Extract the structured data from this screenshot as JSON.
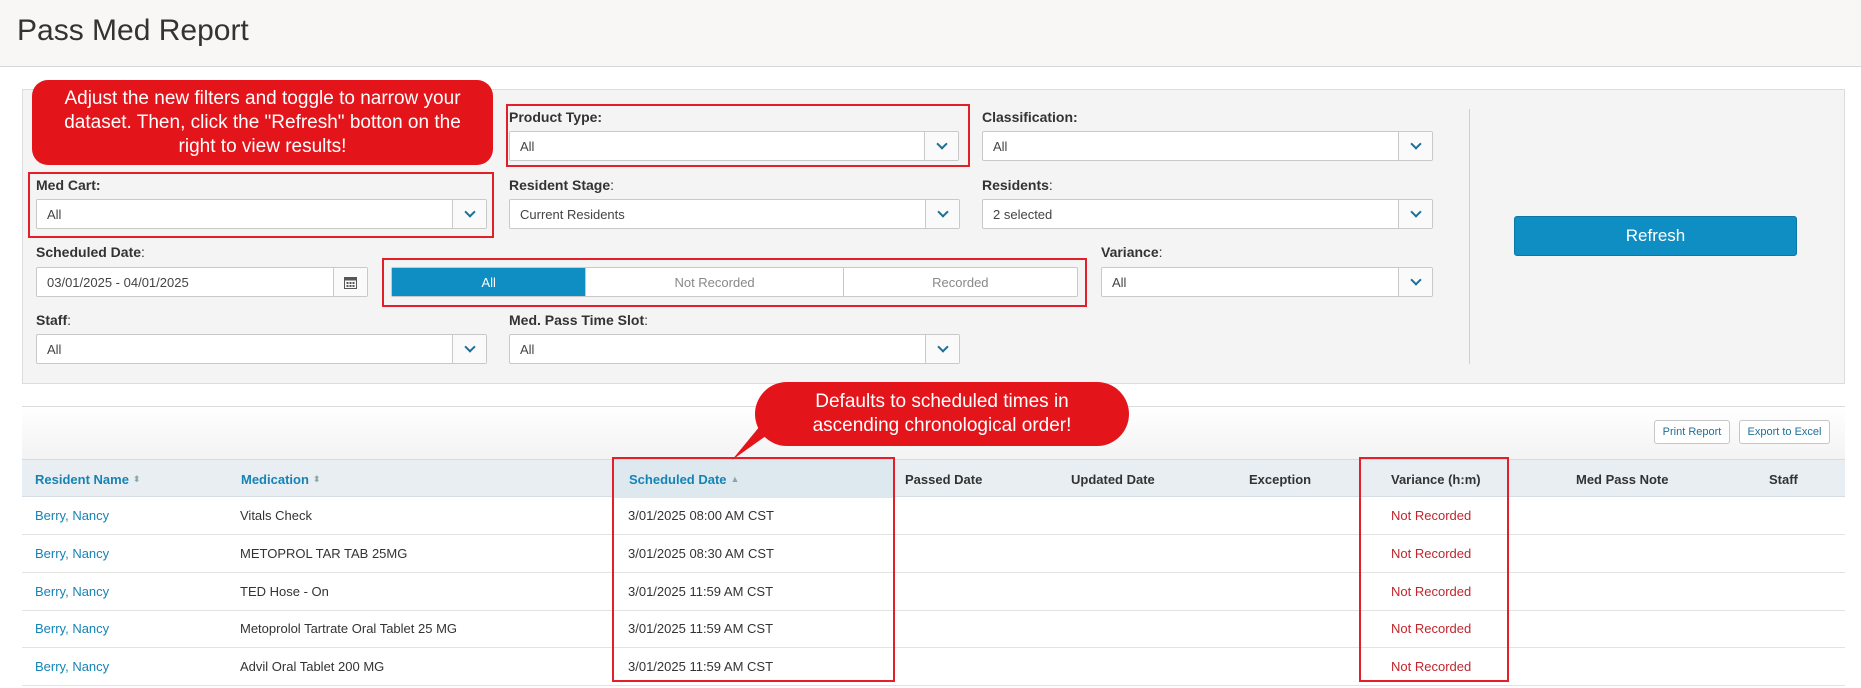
{
  "page": {
    "title": "Pass Med Report"
  },
  "filters": {
    "product_type": {
      "label": "Product Type:",
      "value": "All"
    },
    "classification": {
      "label": "Classification:",
      "value": "All"
    },
    "med_cart": {
      "label": "Med Cart:",
      "value": "All"
    },
    "resident_stage": {
      "label_bold": "Resident Stage",
      "label_suffix": ":",
      "value": "Current Residents"
    },
    "residents": {
      "label_bold": "Residents",
      "label_suffix": ":",
      "value": "2 selected"
    },
    "scheduled_date": {
      "label_bold": "Scheduled Date",
      "label_suffix": ":",
      "value": "03/01/2025 - 04/01/2025"
    },
    "variance": {
      "label_bold": "Variance",
      "label_suffix": ":",
      "value": "All"
    },
    "staff": {
      "label_bold": "Staff",
      "label_suffix": ":",
      "value": "All"
    },
    "time_slot": {
      "label_bold": "Med. Pass Time Slot",
      "label_suffix": ":",
      "value": "All"
    },
    "record_toggle": {
      "options": [
        "All",
        "Not Recorded",
        "Recorded"
      ],
      "selected": "All"
    },
    "refresh_label": "Refresh"
  },
  "callouts": {
    "filters_tip": "Adjust the new filters and toggle to narrow your dataset. Then, click the \"Refresh\" botton on the right to view results!",
    "sort_tip": "Defaults to scheduled times in ascending chronological order!"
  },
  "toolbar": {
    "print_label": "Print Report",
    "export_label": "Export to Excel"
  },
  "table": {
    "columns": [
      "Resident Name",
      "Medication",
      "Scheduled Date",
      "Passed Date",
      "Updated Date",
      "Exception",
      "Variance (h:m)",
      "Med Pass Note",
      "Staff"
    ],
    "rows": [
      {
        "resident": "Berry, Nancy",
        "medication": "Vitals Check",
        "scheduled": "3/01/2025 08:00 AM CST",
        "variance": "Not Recorded"
      },
      {
        "resident": "Berry, Nancy",
        "medication": "METOPROL TAR TAB 25MG",
        "scheduled": "3/01/2025 08:30 AM CST",
        "variance": "Not Recorded"
      },
      {
        "resident": "Berry, Nancy",
        "medication": "TED Hose - On",
        "scheduled": "3/01/2025 11:59 AM CST",
        "variance": "Not Recorded"
      },
      {
        "resident": "Berry, Nancy",
        "medication": "Metoprolol Tartrate Oral Tablet 25 MG",
        "scheduled": "3/01/2025 11:59 AM CST",
        "variance": "Not Recorded"
      },
      {
        "resident": "Berry, Nancy",
        "medication": "Advil Oral Tablet 200 MG",
        "scheduled": "3/01/2025 11:59 AM CST",
        "variance": "Not Recorded"
      }
    ]
  },
  "colors": {
    "accent": "#0f8ec3",
    "callout": "#e4141b",
    "link": "#1683b5",
    "not_recorded": "#c0262d"
  }
}
